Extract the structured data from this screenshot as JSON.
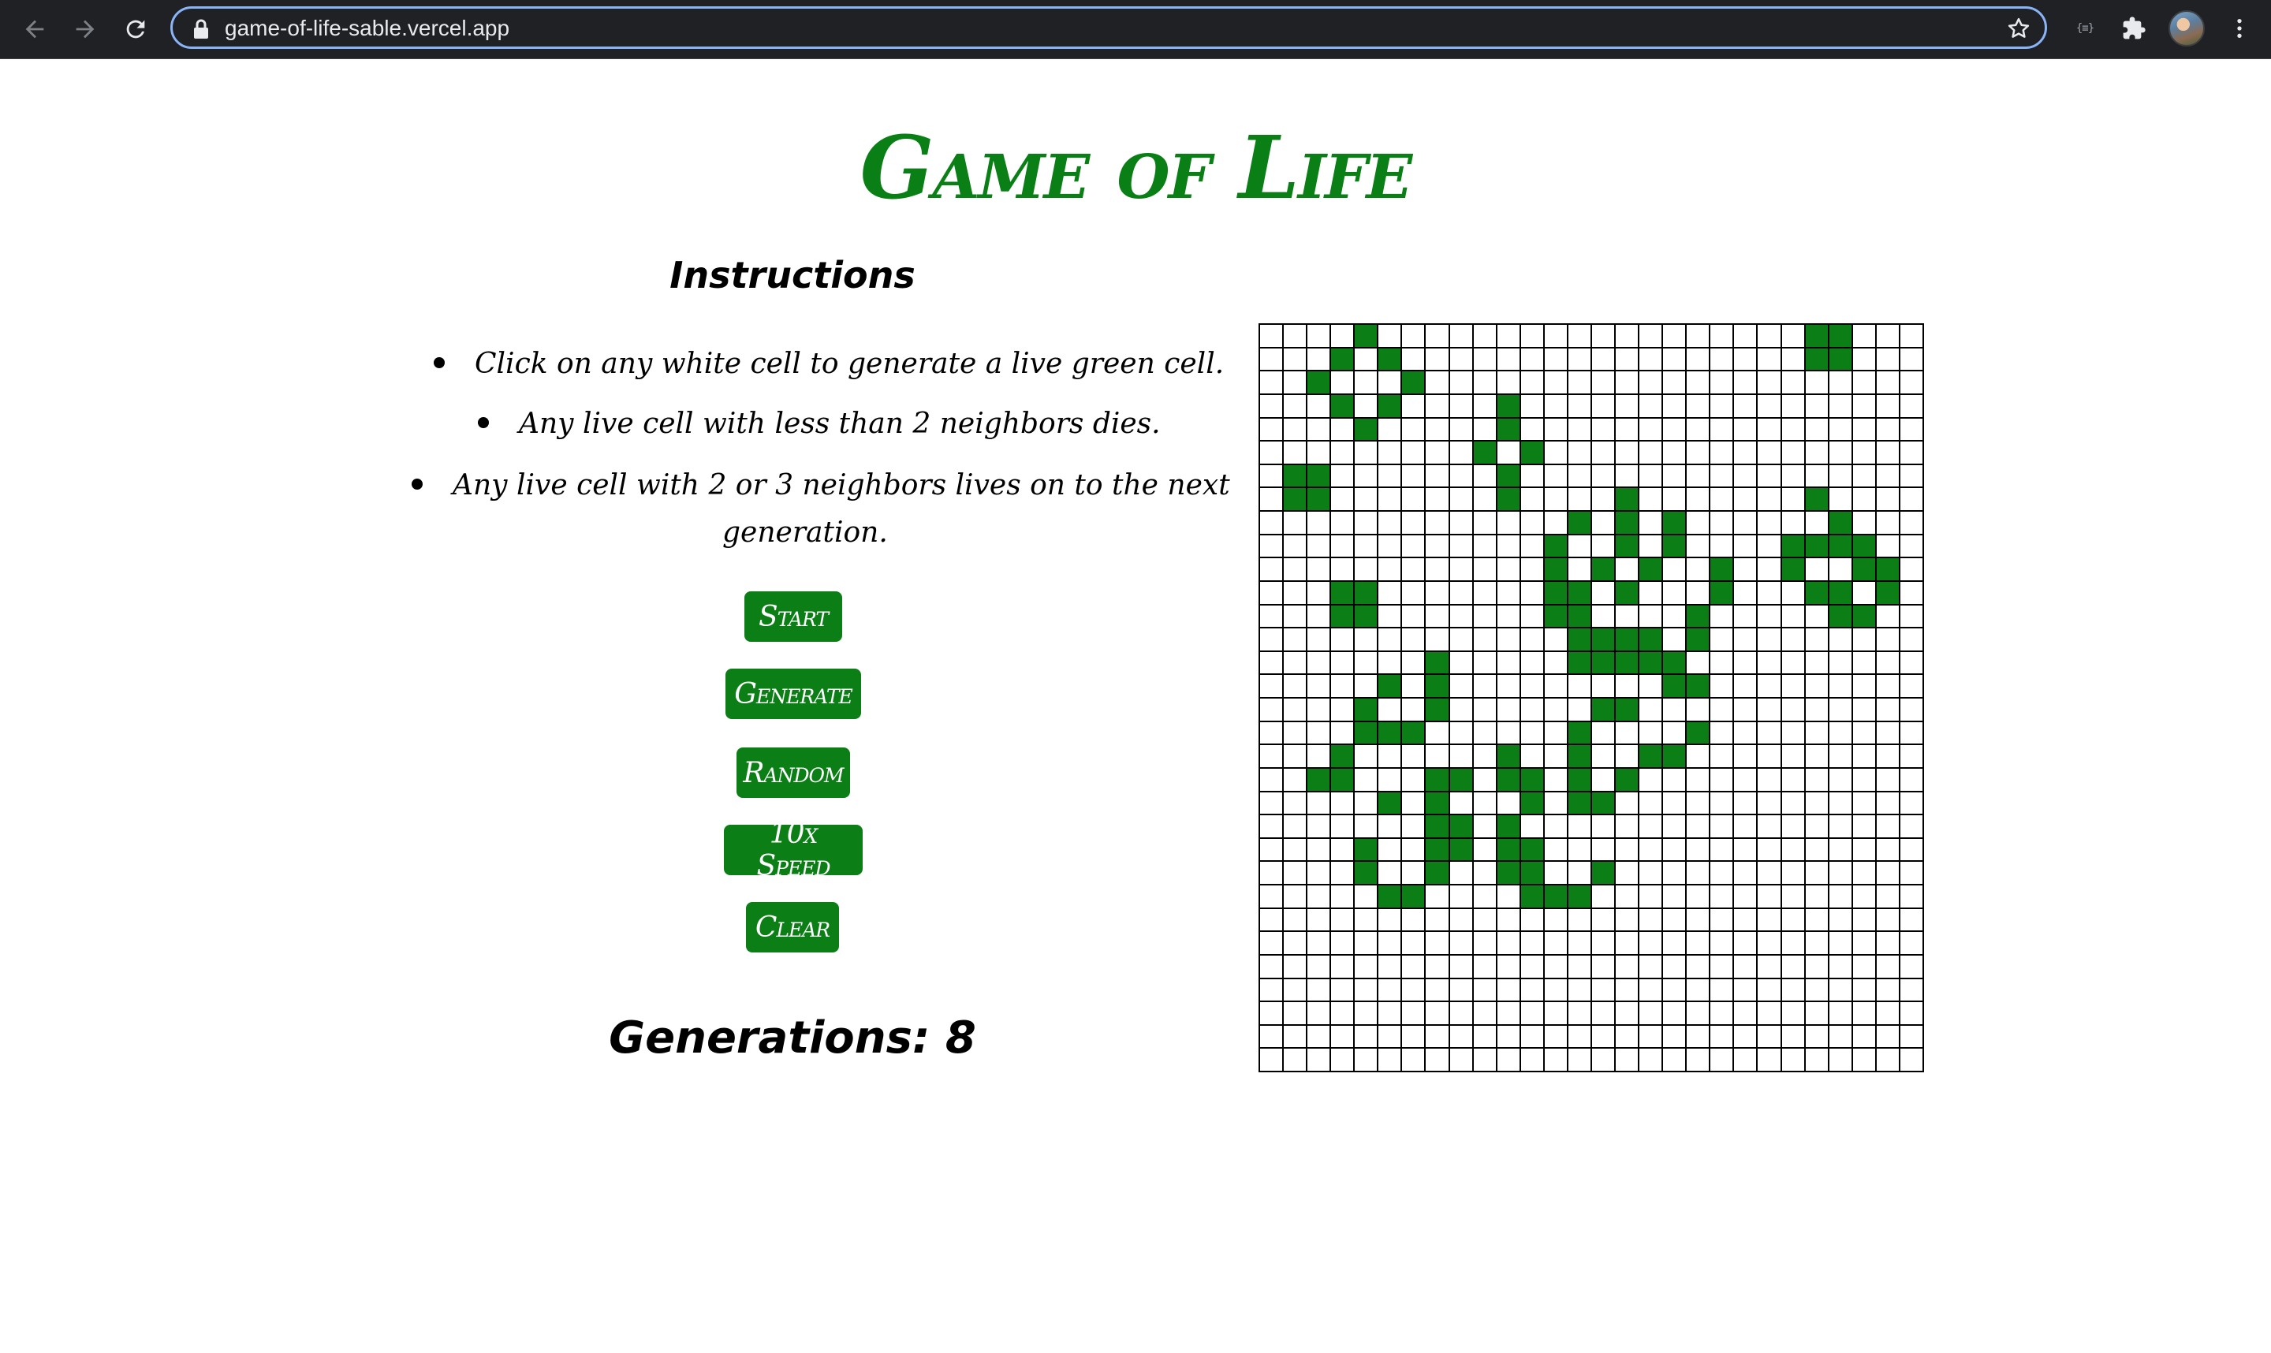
{
  "browser": {
    "url": "game-of-life-sable.vercel.app",
    "extension_label": "{≡}"
  },
  "page": {
    "title": "Game of Life",
    "instructions_title": "Instructions",
    "rules": [
      "Click on any white cell to generate a live green cell.",
      "Any live cell with less than 2 neighbors dies.",
      "Any live cell with 2 or 3 neighbors lives on to the next",
      "generation."
    ],
    "buttons": {
      "start": "Start",
      "generate": "Generate",
      "random": "Random",
      "speed": "10x Speed",
      "clear": "Clear"
    },
    "generations_text": "Generations: 8",
    "accent_color": "#0b7f16"
  },
  "grid": {
    "rows": 32,
    "cols": 28,
    "live_color": "#0b7f16",
    "dead_color": "#ffffff",
    "alive": [
      [
        0,
        4
      ],
      [
        0,
        23
      ],
      [
        0,
        24
      ],
      [
        1,
        3
      ],
      [
        1,
        5
      ],
      [
        1,
        23
      ],
      [
        1,
        24
      ],
      [
        2,
        2
      ],
      [
        2,
        6
      ],
      [
        3,
        3
      ],
      [
        3,
        5
      ],
      [
        3,
        10
      ],
      [
        4,
        4
      ],
      [
        4,
        10
      ],
      [
        5,
        9
      ],
      [
        5,
        11
      ],
      [
        6,
        1
      ],
      [
        6,
        2
      ],
      [
        6,
        10
      ],
      [
        7,
        1
      ],
      [
        7,
        2
      ],
      [
        7,
        10
      ],
      [
        7,
        15
      ],
      [
        7,
        23
      ],
      [
        8,
        13
      ],
      [
        8,
        15
      ],
      [
        8,
        17
      ],
      [
        8,
        24
      ],
      [
        9,
        12
      ],
      [
        9,
        15
      ],
      [
        9,
        17
      ],
      [
        9,
        22
      ],
      [
        9,
        23
      ],
      [
        9,
        24
      ],
      [
        9,
        25
      ],
      [
        10,
        12
      ],
      [
        10,
        14
      ],
      [
        10,
        16
      ],
      [
        10,
        19
      ],
      [
        10,
        22
      ],
      [
        10,
        25
      ],
      [
        10,
        26
      ],
      [
        11,
        3
      ],
      [
        11,
        4
      ],
      [
        11,
        12
      ],
      [
        11,
        13
      ],
      [
        11,
        15
      ],
      [
        11,
        19
      ],
      [
        11,
        23
      ],
      [
        11,
        24
      ],
      [
        11,
        26
      ],
      [
        12,
        3
      ],
      [
        12,
        4
      ],
      [
        12,
        12
      ],
      [
        12,
        13
      ],
      [
        12,
        18
      ],
      [
        12,
        24
      ],
      [
        12,
        25
      ],
      [
        13,
        13
      ],
      [
        13,
        14
      ],
      [
        13,
        15
      ],
      [
        13,
        16
      ],
      [
        13,
        18
      ],
      [
        14,
        13
      ],
      [
        14,
        14
      ],
      [
        14,
        15
      ],
      [
        14,
        16
      ],
      [
        14,
        17
      ],
      [
        14,
        7
      ],
      [
        15,
        5
      ],
      [
        15,
        7
      ],
      [
        15,
        17
      ],
      [
        15,
        18
      ],
      [
        16,
        4
      ],
      [
        16,
        7
      ],
      [
        16,
        14
      ],
      [
        16,
        15
      ],
      [
        17,
        4
      ],
      [
        17,
        5
      ],
      [
        17,
        6
      ],
      [
        17,
        13
      ],
      [
        17,
        18
      ],
      [
        18,
        3
      ],
      [
        18,
        10
      ],
      [
        18,
        13
      ],
      [
        18,
        16
      ],
      [
        18,
        17
      ],
      [
        19,
        2
      ],
      [
        19,
        3
      ],
      [
        19,
        7
      ],
      [
        19,
        8
      ],
      [
        19,
        10
      ],
      [
        19,
        11
      ],
      [
        19,
        13
      ],
      [
        19,
        15
      ],
      [
        20,
        5
      ],
      [
        20,
        7
      ],
      [
        20,
        11
      ],
      [
        20,
        13
      ],
      [
        20,
        14
      ],
      [
        21,
        7
      ],
      [
        21,
        8
      ],
      [
        21,
        10
      ],
      [
        22,
        4
      ],
      [
        22,
        7
      ],
      [
        22,
        8
      ],
      [
        22,
        10
      ],
      [
        22,
        11
      ],
      [
        23,
        4
      ],
      [
        23,
        7
      ],
      [
        23,
        10
      ],
      [
        23,
        11
      ],
      [
        23,
        14
      ],
      [
        24,
        5
      ],
      [
        24,
        6
      ],
      [
        24,
        11
      ],
      [
        24,
        12
      ],
      [
        24,
        13
      ]
    ]
  }
}
